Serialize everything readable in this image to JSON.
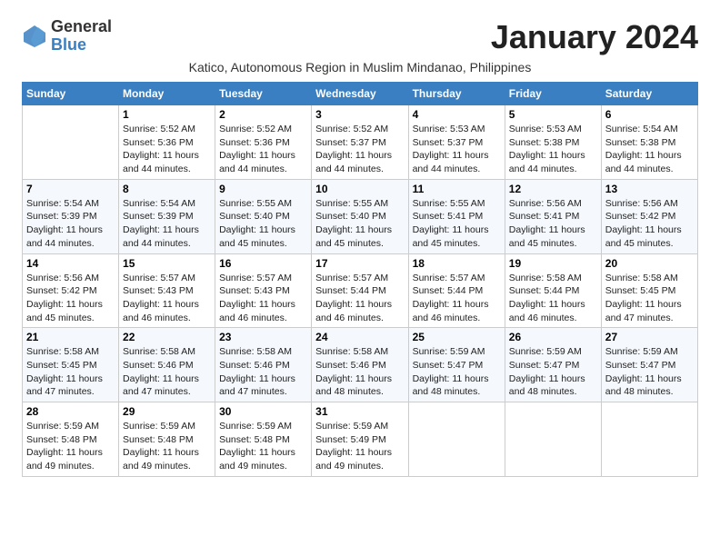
{
  "logo": {
    "general": "General",
    "blue": "Blue"
  },
  "title": "January 2024",
  "location": "Katico, Autonomous Region in Muslim Mindanao, Philippines",
  "headers": [
    "Sunday",
    "Monday",
    "Tuesday",
    "Wednesday",
    "Thursday",
    "Friday",
    "Saturday"
  ],
  "weeks": [
    [
      {
        "day": "",
        "sunrise": "",
        "sunset": "",
        "daylight": ""
      },
      {
        "day": "1",
        "sunrise": "Sunrise: 5:52 AM",
        "sunset": "Sunset: 5:36 PM",
        "daylight": "Daylight: 11 hours and 44 minutes."
      },
      {
        "day": "2",
        "sunrise": "Sunrise: 5:52 AM",
        "sunset": "Sunset: 5:36 PM",
        "daylight": "Daylight: 11 hours and 44 minutes."
      },
      {
        "day": "3",
        "sunrise": "Sunrise: 5:52 AM",
        "sunset": "Sunset: 5:37 PM",
        "daylight": "Daylight: 11 hours and 44 minutes."
      },
      {
        "day": "4",
        "sunrise": "Sunrise: 5:53 AM",
        "sunset": "Sunset: 5:37 PM",
        "daylight": "Daylight: 11 hours and 44 minutes."
      },
      {
        "day": "5",
        "sunrise": "Sunrise: 5:53 AM",
        "sunset": "Sunset: 5:38 PM",
        "daylight": "Daylight: 11 hours and 44 minutes."
      },
      {
        "day": "6",
        "sunrise": "Sunrise: 5:54 AM",
        "sunset": "Sunset: 5:38 PM",
        "daylight": "Daylight: 11 hours and 44 minutes."
      }
    ],
    [
      {
        "day": "7",
        "sunrise": "Sunrise: 5:54 AM",
        "sunset": "Sunset: 5:39 PM",
        "daylight": "Daylight: 11 hours and 44 minutes."
      },
      {
        "day": "8",
        "sunrise": "Sunrise: 5:54 AM",
        "sunset": "Sunset: 5:39 PM",
        "daylight": "Daylight: 11 hours and 44 minutes."
      },
      {
        "day": "9",
        "sunrise": "Sunrise: 5:55 AM",
        "sunset": "Sunset: 5:40 PM",
        "daylight": "Daylight: 11 hours and 45 minutes."
      },
      {
        "day": "10",
        "sunrise": "Sunrise: 5:55 AM",
        "sunset": "Sunset: 5:40 PM",
        "daylight": "Daylight: 11 hours and 45 minutes."
      },
      {
        "day": "11",
        "sunrise": "Sunrise: 5:55 AM",
        "sunset": "Sunset: 5:41 PM",
        "daylight": "Daylight: 11 hours and 45 minutes."
      },
      {
        "day": "12",
        "sunrise": "Sunrise: 5:56 AM",
        "sunset": "Sunset: 5:41 PM",
        "daylight": "Daylight: 11 hours and 45 minutes."
      },
      {
        "day": "13",
        "sunrise": "Sunrise: 5:56 AM",
        "sunset": "Sunset: 5:42 PM",
        "daylight": "Daylight: 11 hours and 45 minutes."
      }
    ],
    [
      {
        "day": "14",
        "sunrise": "Sunrise: 5:56 AM",
        "sunset": "Sunset: 5:42 PM",
        "daylight": "Daylight: 11 hours and 45 minutes."
      },
      {
        "day": "15",
        "sunrise": "Sunrise: 5:57 AM",
        "sunset": "Sunset: 5:43 PM",
        "daylight": "Daylight: 11 hours and 46 minutes."
      },
      {
        "day": "16",
        "sunrise": "Sunrise: 5:57 AM",
        "sunset": "Sunset: 5:43 PM",
        "daylight": "Daylight: 11 hours and 46 minutes."
      },
      {
        "day": "17",
        "sunrise": "Sunrise: 5:57 AM",
        "sunset": "Sunset: 5:44 PM",
        "daylight": "Daylight: 11 hours and 46 minutes."
      },
      {
        "day": "18",
        "sunrise": "Sunrise: 5:57 AM",
        "sunset": "Sunset: 5:44 PM",
        "daylight": "Daylight: 11 hours and 46 minutes."
      },
      {
        "day": "19",
        "sunrise": "Sunrise: 5:58 AM",
        "sunset": "Sunset: 5:44 PM",
        "daylight": "Daylight: 11 hours and 46 minutes."
      },
      {
        "day": "20",
        "sunrise": "Sunrise: 5:58 AM",
        "sunset": "Sunset: 5:45 PM",
        "daylight": "Daylight: 11 hours and 47 minutes."
      }
    ],
    [
      {
        "day": "21",
        "sunrise": "Sunrise: 5:58 AM",
        "sunset": "Sunset: 5:45 PM",
        "daylight": "Daylight: 11 hours and 47 minutes."
      },
      {
        "day": "22",
        "sunrise": "Sunrise: 5:58 AM",
        "sunset": "Sunset: 5:46 PM",
        "daylight": "Daylight: 11 hours and 47 minutes."
      },
      {
        "day": "23",
        "sunrise": "Sunrise: 5:58 AM",
        "sunset": "Sunset: 5:46 PM",
        "daylight": "Daylight: 11 hours and 47 minutes."
      },
      {
        "day": "24",
        "sunrise": "Sunrise: 5:58 AM",
        "sunset": "Sunset: 5:46 PM",
        "daylight": "Daylight: 11 hours and 48 minutes."
      },
      {
        "day": "25",
        "sunrise": "Sunrise: 5:59 AM",
        "sunset": "Sunset: 5:47 PM",
        "daylight": "Daylight: 11 hours and 48 minutes."
      },
      {
        "day": "26",
        "sunrise": "Sunrise: 5:59 AM",
        "sunset": "Sunset: 5:47 PM",
        "daylight": "Daylight: 11 hours and 48 minutes."
      },
      {
        "day": "27",
        "sunrise": "Sunrise: 5:59 AM",
        "sunset": "Sunset: 5:47 PM",
        "daylight": "Daylight: 11 hours and 48 minutes."
      }
    ],
    [
      {
        "day": "28",
        "sunrise": "Sunrise: 5:59 AM",
        "sunset": "Sunset: 5:48 PM",
        "daylight": "Daylight: 11 hours and 49 minutes."
      },
      {
        "day": "29",
        "sunrise": "Sunrise: 5:59 AM",
        "sunset": "Sunset: 5:48 PM",
        "daylight": "Daylight: 11 hours and 49 minutes."
      },
      {
        "day": "30",
        "sunrise": "Sunrise: 5:59 AM",
        "sunset": "Sunset: 5:48 PM",
        "daylight": "Daylight: 11 hours and 49 minutes."
      },
      {
        "day": "31",
        "sunrise": "Sunrise: 5:59 AM",
        "sunset": "Sunset: 5:49 PM",
        "daylight": "Daylight: 11 hours and 49 minutes."
      },
      {
        "day": "",
        "sunrise": "",
        "sunset": "",
        "daylight": ""
      },
      {
        "day": "",
        "sunrise": "",
        "sunset": "",
        "daylight": ""
      },
      {
        "day": "",
        "sunrise": "",
        "sunset": "",
        "daylight": ""
      }
    ]
  ]
}
